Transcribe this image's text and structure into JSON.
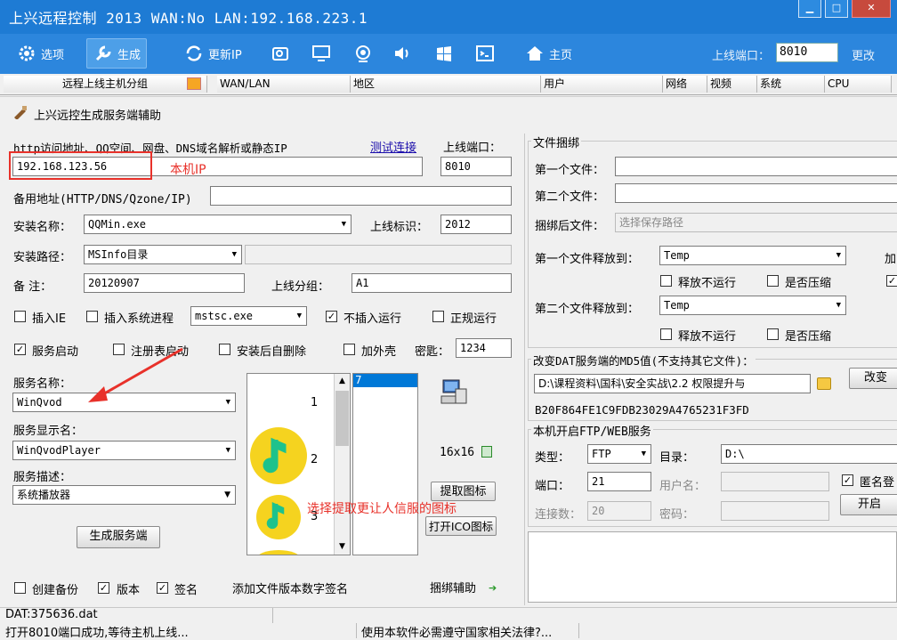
{
  "window": {
    "title": "上兴远程控制 2013 WAN:No LAN:192.168.223.1"
  },
  "toolbar": {
    "items": [
      {
        "label": "选项",
        "icon": "gear-icon"
      },
      {
        "label": "生成",
        "icon": "wrench-icon"
      },
      {
        "label": "更新IP",
        "icon": "refresh-ip-icon"
      },
      {
        "label": "",
        "icon": "file-manager-icon"
      },
      {
        "label": "",
        "icon": "screen-icon"
      },
      {
        "label": "",
        "icon": "webcam-icon"
      },
      {
        "label": "",
        "icon": "speaker-icon"
      },
      {
        "label": "",
        "icon": "windows-icon"
      },
      {
        "label": "",
        "icon": "terminal-icon"
      },
      {
        "label": "主页",
        "icon": "home-icon"
      }
    ],
    "port_label": "上线端口：",
    "port_value": "8010",
    "change_label": "更改"
  },
  "host_list": {
    "group_header": "远程上线主机分组",
    "columns": [
      "WAN/LAN",
      "地区",
      "用户",
      "网络",
      "视频",
      "系统",
      "CPU"
    ]
  },
  "dialog": {
    "title": "上兴远控生成服务端辅助",
    "url_label": "http访问地址、QQ空间、网盘、DNS域名解析或静态IP",
    "test_link": "测试连接",
    "port_label": "上线端口：",
    "url_value": "192.168.123.56",
    "port_value": "8010",
    "annot_ip": "本机IP",
    "backup_label": "备用地址(HTTP/DNS/Qzone/IP)",
    "backup_value": "",
    "install_name_label": "安装名称：",
    "install_name_value": "QQMin.exe",
    "online_id_label": "上线标识：",
    "online_id_value": "2012",
    "install_path_label": "安装路径：",
    "install_path_value": "MSInfo目录",
    "note_label": "备    注：",
    "note_value": "20120907",
    "group_label": "上线分组：",
    "group_value": "A1",
    "insert_ie_label": "插入IE",
    "insert_proc_label": "插入系统进程",
    "proc_value": "mstsc.exe",
    "no_insert_label": "不插入运行",
    "normal_run_label": "正规运行",
    "service_start_label": "服务启动",
    "reg_start_label": "注册表启动",
    "self_delete_label": "安装后自删除",
    "shell_label": "加外壳",
    "key_label": "密匙：",
    "key_value": "1234",
    "svc_name_label": "服务名称：",
    "svc_name_value": "WinQvod",
    "svc_display_label": "服务显示名：",
    "svc_display_value": "WinQvodPlayer",
    "svc_desc_label": "服务描述：",
    "svc_desc_value": "系统播放器",
    "generate_btn": "生成服务端",
    "icon_numbers": [
      "1",
      "2",
      "3"
    ],
    "list_selected": "7",
    "icon_size": "16x16",
    "extract_btn": "提取图标",
    "open_ico_btn": "打开ICO图标",
    "annot_icon": "选择提取更让人信服的图标",
    "backup_chk_label": "创建备份",
    "version_chk_label": "版本",
    "sign_chk_label": "签名",
    "sign_text": "添加文件版本数字签名",
    "bind_helper": "捆绑辅助"
  },
  "bind": {
    "title": "文件捆绑",
    "file1_label": "第一个文件：",
    "file2_label": "第二个文件：",
    "bound_label": "捆绑后文件：",
    "bound_placeholder": "选择保存路径",
    "release1_label": "第一个文件释放到：",
    "release1_value": "Temp",
    "release2_label": "第二个文件释放到：",
    "release2_value": "Temp",
    "no_run_label": "释放不运行",
    "compress_label": "是否压缩",
    "cut_label": "加"
  },
  "md5": {
    "title": "改变DAT服务端的MD5值(不支持其它文件)：",
    "path_value": "D:\\课程资料\\国科\\安全实战\\2.2 权限提升与",
    "change_btn": "改变",
    "hash_value": "B20F864FE1C9FDB23029A4765231F3FD"
  },
  "ftp": {
    "title": "本机开启FTP/WEB服务",
    "type_label": "类型：",
    "type_value": "FTP",
    "dir_label": "目录：",
    "dir_value": "D:\\",
    "port_label": "端口：",
    "port_value": "21",
    "user_label": "用户名：",
    "anon_label": "匿名登",
    "conn_label": "连接数：",
    "conn_value": "20",
    "pass_label": "密码：",
    "start_btn": "开启"
  },
  "status": {
    "dat": "DAT:375636.dat",
    "msg": "打开8010端口成功,等待主机上线...",
    "law": "使用本软件必需遵守国家相关法律?..."
  }
}
